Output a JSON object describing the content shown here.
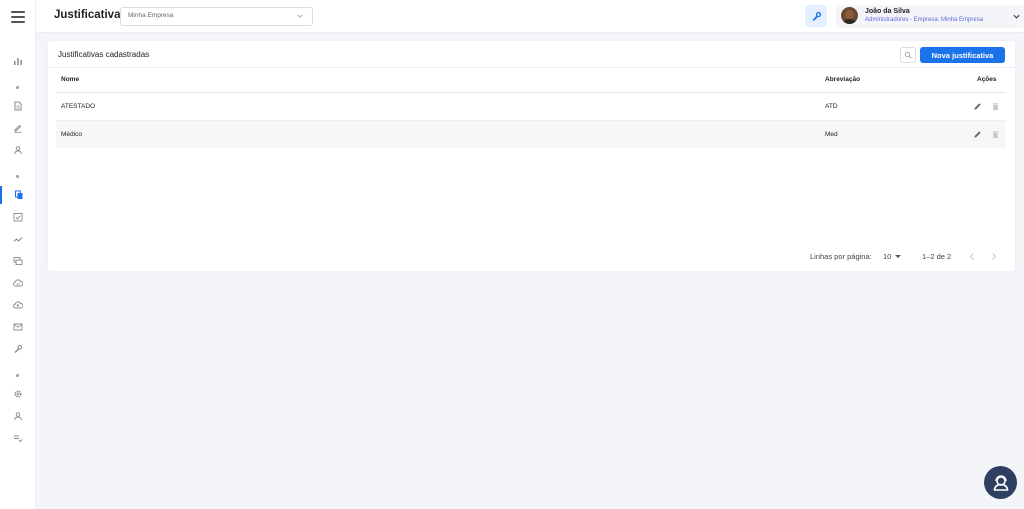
{
  "header": {
    "title": "Justificativas",
    "company_select": "Minha Empresa",
    "user": {
      "name": "João da Silva",
      "role": "Administradores - Empresa: Minha Empresa"
    }
  },
  "card": {
    "title": "Justificativas cadastradas",
    "new_button": "Nova justificativa",
    "columns": {
      "name": "Nome",
      "abbreviation": "Abreviação",
      "actions": "Ações"
    },
    "rows": [
      {
        "name": "ATESTADO",
        "abbreviation": "ATD"
      },
      {
        "name": "Médico",
        "abbreviation": "Med"
      }
    ],
    "pagination": {
      "rows_per_page_label": "Linhas por página:",
      "rows_per_page": "10",
      "range": "1–2 de 2"
    }
  },
  "sidebar": {
    "icons": [
      "menu-icon",
      "chart-icon",
      "document-icon",
      "edit-icon",
      "person-icon",
      "files-icon",
      "calendar-check-icon",
      "trend-icon",
      "chat-icon",
      "cloud-icon",
      "cloud-upload-icon",
      "mail-icon",
      "wrench-icon",
      "gear-icon",
      "user-icon",
      "list-check-icon"
    ]
  },
  "colors": {
    "accent": "#1a73e8",
    "help_fab": "#2f3f62",
    "background": "#f4f5f9"
  }
}
